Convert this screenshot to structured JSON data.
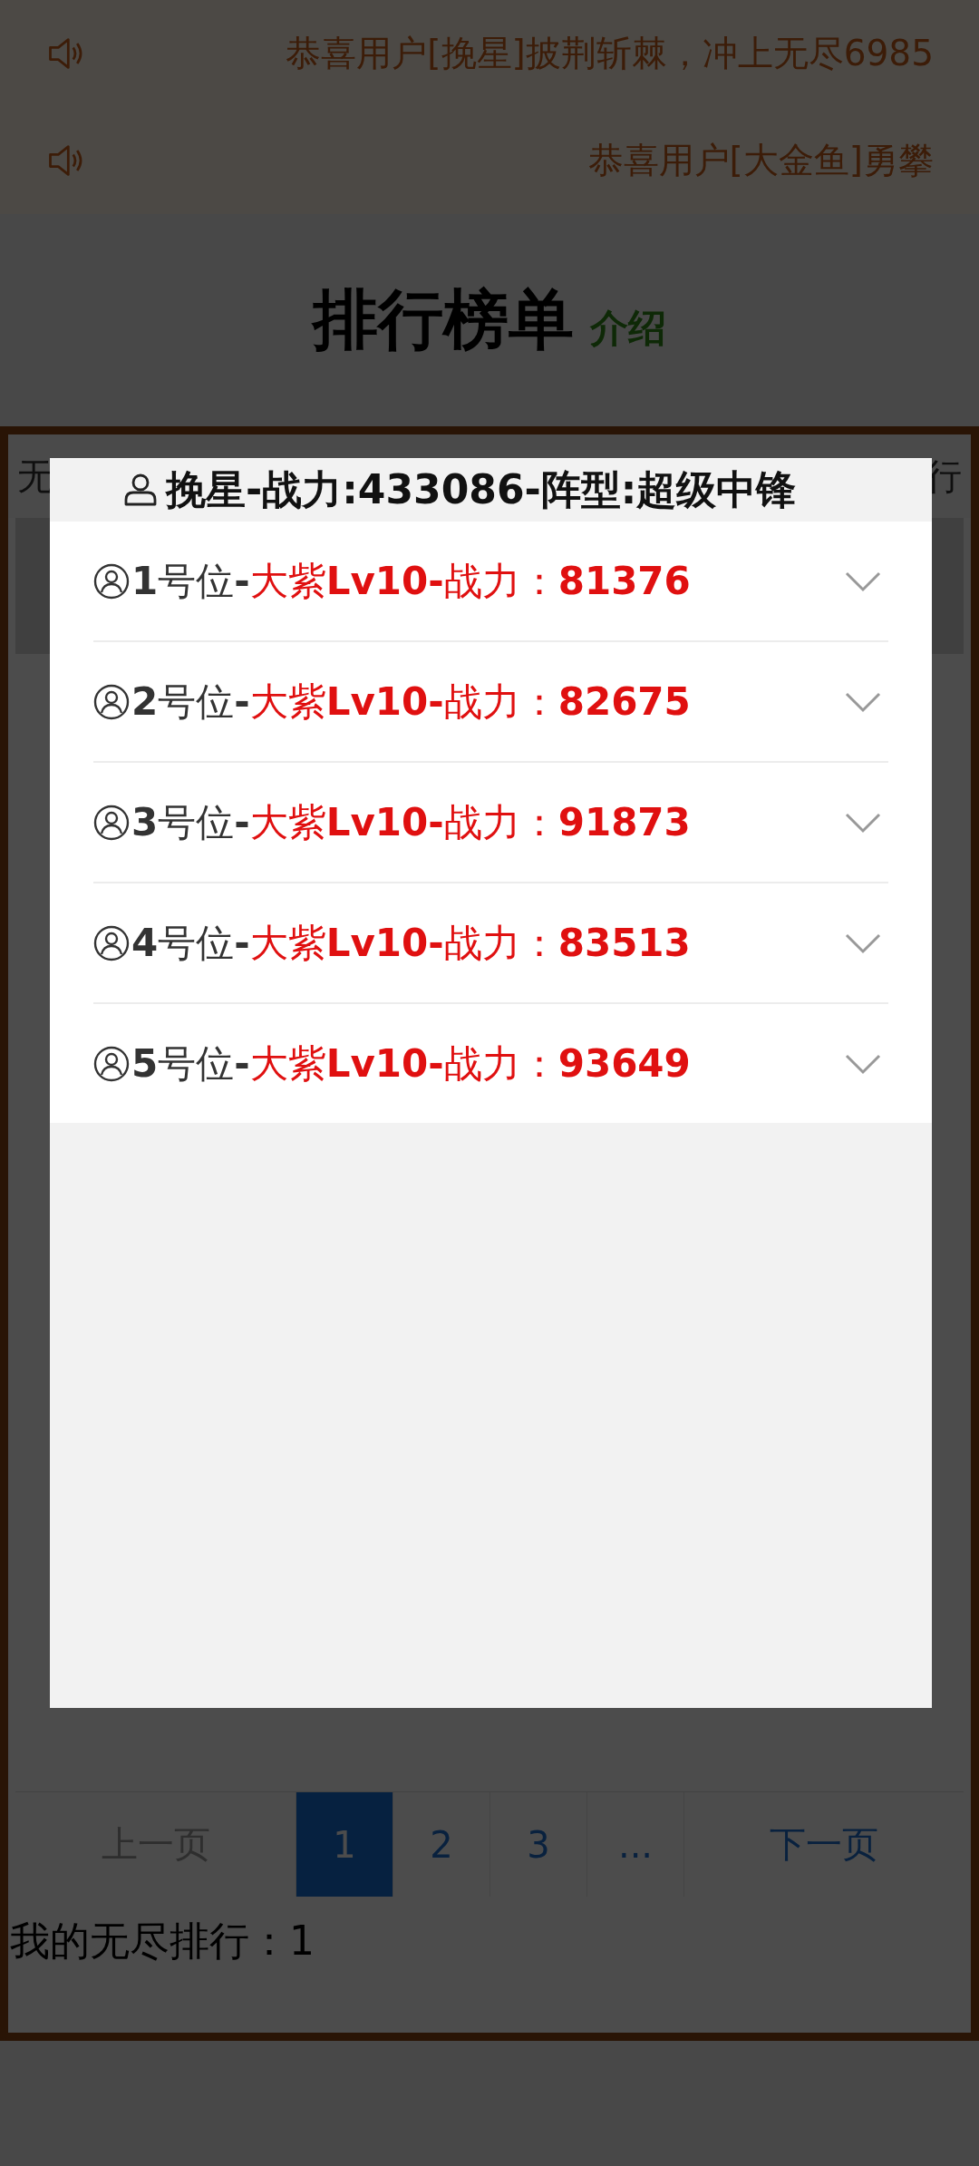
{
  "marquee": [
    {
      "text": "恭喜用户[挽星]披荆斩棘，冲上无尽6985"
    },
    {
      "text": "恭喜用户[大金鱼]勇攀"
    }
  ],
  "title": "排行榜单",
  "intro_link": "介绍",
  "tab_row": {
    "left": "无",
    "right": "行"
  },
  "pagination": {
    "prev": {
      "label": "上一页",
      "disabled": true
    },
    "pages": [
      {
        "label": "1",
        "selected": true
      },
      {
        "label": "2",
        "selected": false
      },
      {
        "label": "3",
        "selected": false
      },
      {
        "label": "...",
        "selected": false
      }
    ],
    "next": {
      "label": "下一页",
      "disabled": false
    }
  },
  "my_rank": "我的无尽排行：1",
  "dialog": {
    "title": "挽星-战力:433086-阵型:超级中锋",
    "slots": [
      {
        "position": "**1**号位**-**",
        "hero": "大紫**Lv10-**战力：",
        "power": "81376",
        "expanded": false
      },
      {
        "position": "**2**号位**-**",
        "hero": "大紫**Lv10-**战力：",
        "power": "82675",
        "expanded": false
      },
      {
        "position": "**3**号位**-**",
        "hero": "大紫**Lv10-**战力：",
        "power": "91873",
        "expanded": false
      },
      {
        "position": "**4**号位**-**",
        "hero": "大紫**Lv10-**战力：",
        "power": "83513",
        "expanded": false
      },
      {
        "position": "**5**号位**-**",
        "hero": "大紫**Lv10-**战力：",
        "power": "93649",
        "expanded": false
      }
    ]
  }
}
